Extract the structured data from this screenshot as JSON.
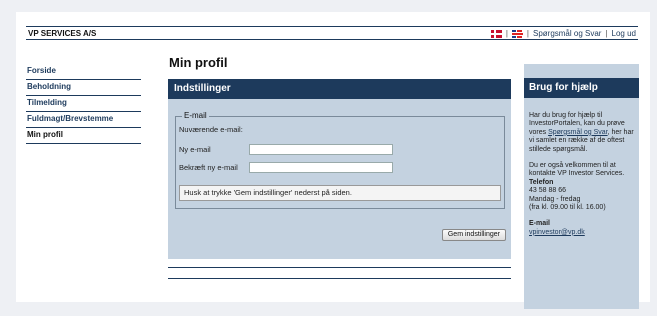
{
  "header": {
    "brand": "VP SERVICES A/S",
    "faq_label": "Spørgsmål og Svar",
    "logout_label": "Log ud",
    "separator": "|"
  },
  "sidebar": {
    "items": [
      {
        "label": "Forside"
      },
      {
        "label": "Beholdning"
      },
      {
        "label": "Tilmelding"
      },
      {
        "label": "Fuldmagt/Brevstemme"
      },
      {
        "label": "Min profil"
      }
    ]
  },
  "page": {
    "title": "Min profil"
  },
  "settings": {
    "heading": "Indstillinger",
    "legend": "E-mail",
    "current_email_label": "Nuværende e-mail:",
    "new_email_label": "Ny e-mail",
    "new_email_value": "",
    "confirm_email_label": "Bekræft ny e-mail",
    "confirm_email_value": "",
    "notice": "Husk at trykke 'Gem indstillinger' nederst på siden.",
    "save_label": "Gem indstillinger"
  },
  "help": {
    "heading": "Brug for hjælp",
    "intro_1": "Har du brug for hjælp til InvestorPortalen, kan du prøve vores ",
    "faq_link": "Spørgsmål og Svar",
    "intro_2": ", her har vi samlet en række af de oftest stillede spørgsmål.",
    "contact_text": "Du er også velkommen til at kontakte VP Investor Services.",
    "phone_heading": "Telefon",
    "phone_number": "43 58 88 66",
    "phone_days": "Mandag - fredag",
    "phone_hours": "(fra kl. 09.00 til kl. 16.00)",
    "email_heading": "E-mail",
    "email_link": "vpinvestor@vp.dk"
  },
  "colors": {
    "navy": "#1d3a5c",
    "panel_blue": "#c4d2e0",
    "page_bg": "#eef0f4"
  }
}
